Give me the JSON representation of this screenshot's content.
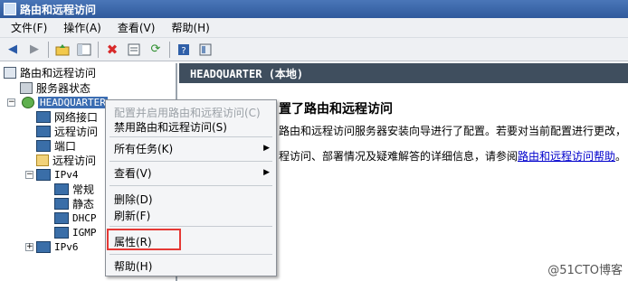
{
  "window": {
    "title": "路由和远程访问"
  },
  "menu": [
    "文件(F)",
    "操作(A)",
    "查看(V)",
    "帮助(H)"
  ],
  "toolbar": {
    "icons": [
      "back-icon",
      "forward-icon",
      "up-folder-icon",
      "show-hide-tree-icon",
      "delete-icon",
      "properties-icon",
      "refresh-icon",
      "help-icon",
      "extra-icon"
    ],
    "delete_color": "#d82a2a"
  },
  "tree": {
    "root": "路由和远程访问",
    "server_status": "服务器状态",
    "headquarter": "HEADQUARTER",
    "network_interfaces": "网络接口",
    "remote_clients": "远程访问",
    "ports": "端口",
    "remote_logging": "远程访问",
    "ipv4": "IPv4",
    "ipv4_children": [
      "常规",
      "静态",
      "DHCP",
      "IGMP"
    ],
    "ipv6": "IPv6"
  },
  "right_pane": {
    "header": "HEADQUARTER (本地)",
    "heading": "置了路由和远程访问",
    "line1": "路由和远程访问服务器安装向导进行了配置。若要对当前配置进行更改，",
    "line2_prefix": "程访问、部署情况及疑难解答的详细信息，请参阅",
    "line2_link": "路由和远程访问帮助",
    "line2_suffix": "。"
  },
  "context_menu": {
    "configure": "配置并启用路由和远程访问(C)",
    "disable": "禁用路由和远程访问(S)",
    "all_tasks": "所有任务(K)",
    "view": "查看(V)",
    "delete": "删除(D)",
    "refresh": "刷新(F)",
    "properties": "属性(R)",
    "help": "帮助(H)",
    "highlight_color": "#e53935"
  },
  "watermark": "@51CTO博客"
}
